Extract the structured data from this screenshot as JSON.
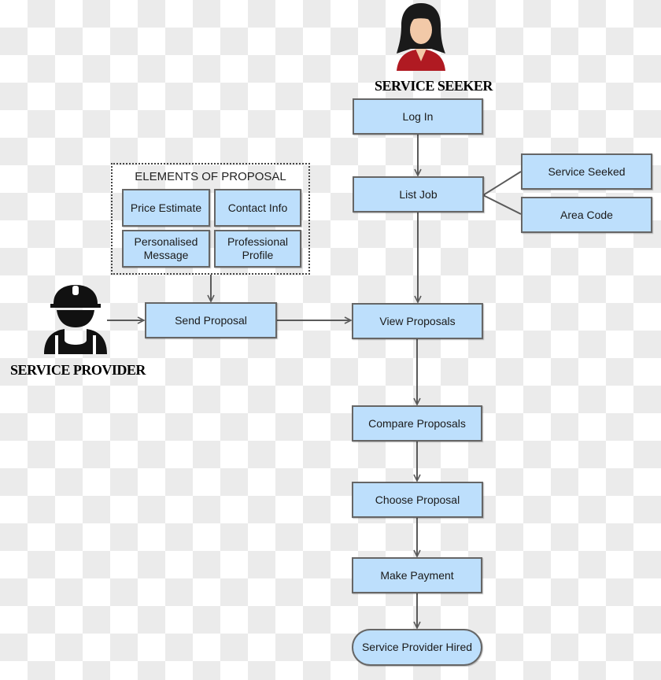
{
  "actors": {
    "seeker": {
      "label": "SERVICE SEEKER",
      "icon": "woman-avatar-icon"
    },
    "provider": {
      "label": "SERVICE PROVIDER",
      "icon": "construction-worker-icon"
    }
  },
  "seeker_flow": {
    "log_in": "Log In",
    "list_job": "List Job",
    "view_proposals": "View Proposals",
    "compare_proposals": "Compare Proposals",
    "choose_proposal": "Choose Proposal",
    "make_payment": "Make Payment",
    "hired": "Service Provider Hired"
  },
  "job_details": {
    "service_seeked": "Service Seeked",
    "area_code": "Area Code"
  },
  "proposal": {
    "group_title": "ELEMENTS OF PROPOSAL",
    "elements": [
      "Price Estimate",
      "Contact Info",
      "Personalised Message",
      "Professional Profile"
    ],
    "send": "Send Proposal"
  },
  "colors": {
    "box_fill": "#bddffc",
    "box_border": "#666666",
    "connector": "#5a5a5a"
  }
}
